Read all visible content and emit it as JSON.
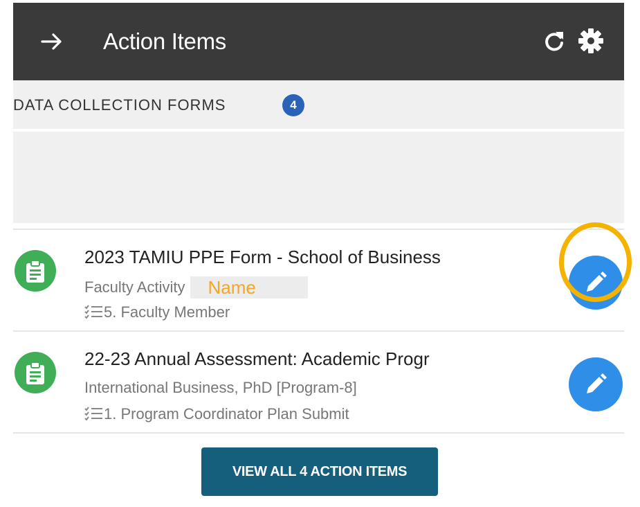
{
  "header": {
    "title": "Action Items",
    "back_icon": "arrow-right-icon",
    "refresh_icon": "refresh-icon",
    "settings_icon": "gear-icon"
  },
  "section": {
    "label": "DATA COLLECTION FORMS",
    "count": "4"
  },
  "items": [
    {
      "title": "2023 TAMIU PPE Form - School of Business",
      "subtitle": "Faculty Activity",
      "name_overlay": "Name",
      "step": "5. Faculty Member",
      "icon": "clipboard-icon",
      "action_icon": "pencil-icon",
      "highlighted": true
    },
    {
      "title": "22-23 Annual Assessment: Academic Progr",
      "subtitle": "International Business, PhD [Program-8]",
      "step": "1. Program Coordinator Plan Submit",
      "icon": "clipboard-icon",
      "action_icon": "pencil-icon",
      "highlighted": false
    }
  ],
  "footer": {
    "view_all_label": "VIEW ALL 4 ACTION ITEMS"
  },
  "colors": {
    "header_bg": "#3a3a3a",
    "badge_blue": "#2a62b7",
    "form_icon_green": "#3fae57",
    "edit_button_blue": "#2f8ee8",
    "highlight_ring": "#f5b300",
    "view_all_bg": "#155e7c"
  }
}
